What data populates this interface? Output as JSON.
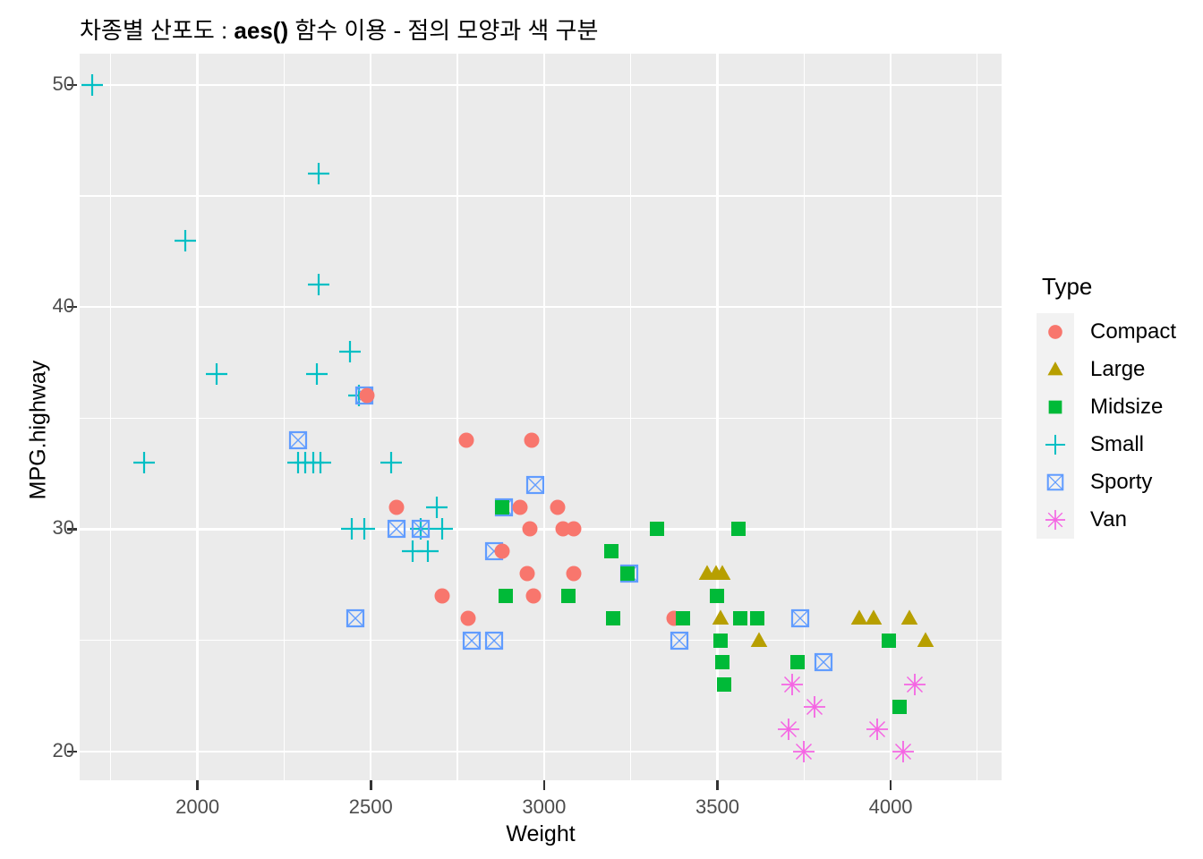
{
  "title": "차종별 산포도 : aes() 함수 이용 - 점의 모양과 색 구분",
  "axes": {
    "x_label": "Weight",
    "y_label": "MPG.highway",
    "x_ticks": [
      "2000",
      "2500",
      "3000",
      "3500",
      "4000"
    ],
    "y_ticks": [
      "20",
      "30",
      "40",
      "50"
    ]
  },
  "legend": {
    "title": "Type",
    "items": [
      {
        "label": "Compact",
        "color": "#F8766D",
        "shape": "circle"
      },
      {
        "label": "Large",
        "color": "#B79F00",
        "shape": "triangle"
      },
      {
        "label": "Midsize",
        "color": "#00BA38",
        "shape": "square"
      },
      {
        "label": "Small",
        "color": "#00BFC4",
        "shape": "plus"
      },
      {
        "label": "Sporty",
        "color": "#619CFF",
        "shape": "square-cross"
      },
      {
        "label": "Van",
        "color": "#F564E3",
        "shape": "asterisk"
      }
    ]
  },
  "chart_data": {
    "type": "scatter",
    "title": "차종별 산포도 : aes() 함수 이용 - 점의 모양과 색 구분",
    "xlabel": "Weight",
    "ylabel": "MPG.highway",
    "xlim": [
      1660,
      4320
    ],
    "ylim": [
      18.7,
      51.4
    ],
    "x_major_ticks": [
      2000,
      2500,
      3000,
      3500,
      4000
    ],
    "x_minor_ticks": [
      1750,
      2250,
      2750,
      3250,
      3750,
      4250
    ],
    "y_major_ticks": [
      20,
      30,
      40,
      50
    ],
    "y_minor_ticks": [
      25,
      35,
      45
    ],
    "grid": true,
    "legend_position": "right",
    "legend_title": "Type",
    "series": [
      {
        "name": "Compact",
        "color": "#F8766D",
        "shape": "circle",
        "points": [
          [
            2490,
            36
          ],
          [
            2575,
            31
          ],
          [
            2705,
            27
          ],
          [
            2775,
            34
          ],
          [
            2780,
            26
          ],
          [
            2880,
            29
          ],
          [
            2930,
            31
          ],
          [
            2950,
            28
          ],
          [
            2960,
            30
          ],
          [
            2965,
            34
          ],
          [
            2970,
            27
          ],
          [
            3040,
            31
          ],
          [
            3055,
            30
          ],
          [
            3085,
            30
          ],
          [
            3085,
            28
          ],
          [
            3375,
            26
          ]
        ]
      },
      {
        "name": "Large",
        "color": "#B79F00",
        "shape": "triangle",
        "points": [
          [
            3470,
            28
          ],
          [
            3495,
            28
          ],
          [
            3515,
            28
          ],
          [
            3510,
            26
          ],
          [
            3620,
            25
          ],
          [
            3910,
            26
          ],
          [
            3950,
            26
          ],
          [
            4055,
            26
          ],
          [
            4100,
            25
          ]
        ]
      },
      {
        "name": "Midsize",
        "color": "#00BA38",
        "shape": "square",
        "points": [
          [
            2880,
            31
          ],
          [
            2890,
            27
          ],
          [
            3070,
            27
          ],
          [
            3195,
            29
          ],
          [
            3240,
            28
          ],
          [
            3200,
            26
          ],
          [
            3325,
            30
          ],
          [
            3400,
            26
          ],
          [
            3500,
            27
          ],
          [
            3510,
            25
          ],
          [
            3515,
            24
          ],
          [
            3520,
            23
          ],
          [
            3560,
            30
          ],
          [
            3565,
            26
          ],
          [
            3615,
            26
          ],
          [
            3730,
            24
          ],
          [
            3995,
            25
          ],
          [
            4025,
            22
          ]
        ]
      },
      {
        "name": "Small",
        "color": "#00BFC4",
        "shape": "plus",
        "points": [
          [
            1695,
            50
          ],
          [
            1845,
            33
          ],
          [
            1965,
            43
          ],
          [
            2055,
            37
          ],
          [
            2290,
            33
          ],
          [
            2310,
            33
          ],
          [
            2335,
            33
          ],
          [
            2350,
            46
          ],
          [
            2345,
            37
          ],
          [
            2350,
            41
          ],
          [
            2355,
            33
          ],
          [
            2440,
            38
          ],
          [
            2445,
            30
          ],
          [
            2465,
            36
          ],
          [
            2480,
            30
          ],
          [
            2560,
            33
          ],
          [
            2620,
            29
          ],
          [
            2645,
            30
          ],
          [
            2665,
            29
          ],
          [
            2690,
            31
          ],
          [
            2705,
            30
          ]
        ]
      },
      {
        "name": "Sporty",
        "color": "#619CFF",
        "shape": "square-cross",
        "points": [
          [
            2290,
            34
          ],
          [
            2455,
            26
          ],
          [
            2480,
            36
          ],
          [
            2575,
            30
          ],
          [
            2645,
            30
          ],
          [
            2790,
            25
          ],
          [
            2855,
            25
          ],
          [
            2855,
            29
          ],
          [
            2885,
            31
          ],
          [
            2975,
            32
          ],
          [
            3245,
            28
          ],
          [
            3390,
            25
          ],
          [
            3740,
            26
          ],
          [
            3805,
            24
          ]
        ]
      },
      {
        "name": "Van",
        "color": "#F564E3",
        "shape": "asterisk",
        "points": [
          [
            3705,
            21
          ],
          [
            3715,
            23
          ],
          [
            3750,
            20
          ],
          [
            3780,
            22
          ],
          [
            3960,
            21
          ],
          [
            4035,
            20
          ],
          [
            4070,
            23
          ]
        ]
      }
    ]
  },
  "style": {
    "panel_bg": "#EBEBEB",
    "grid_color": "#FFFFFF",
    "legend_key_bg": "#F2F2F2",
    "tick_color": "#4D4D4D",
    "text_color": "#000000"
  }
}
